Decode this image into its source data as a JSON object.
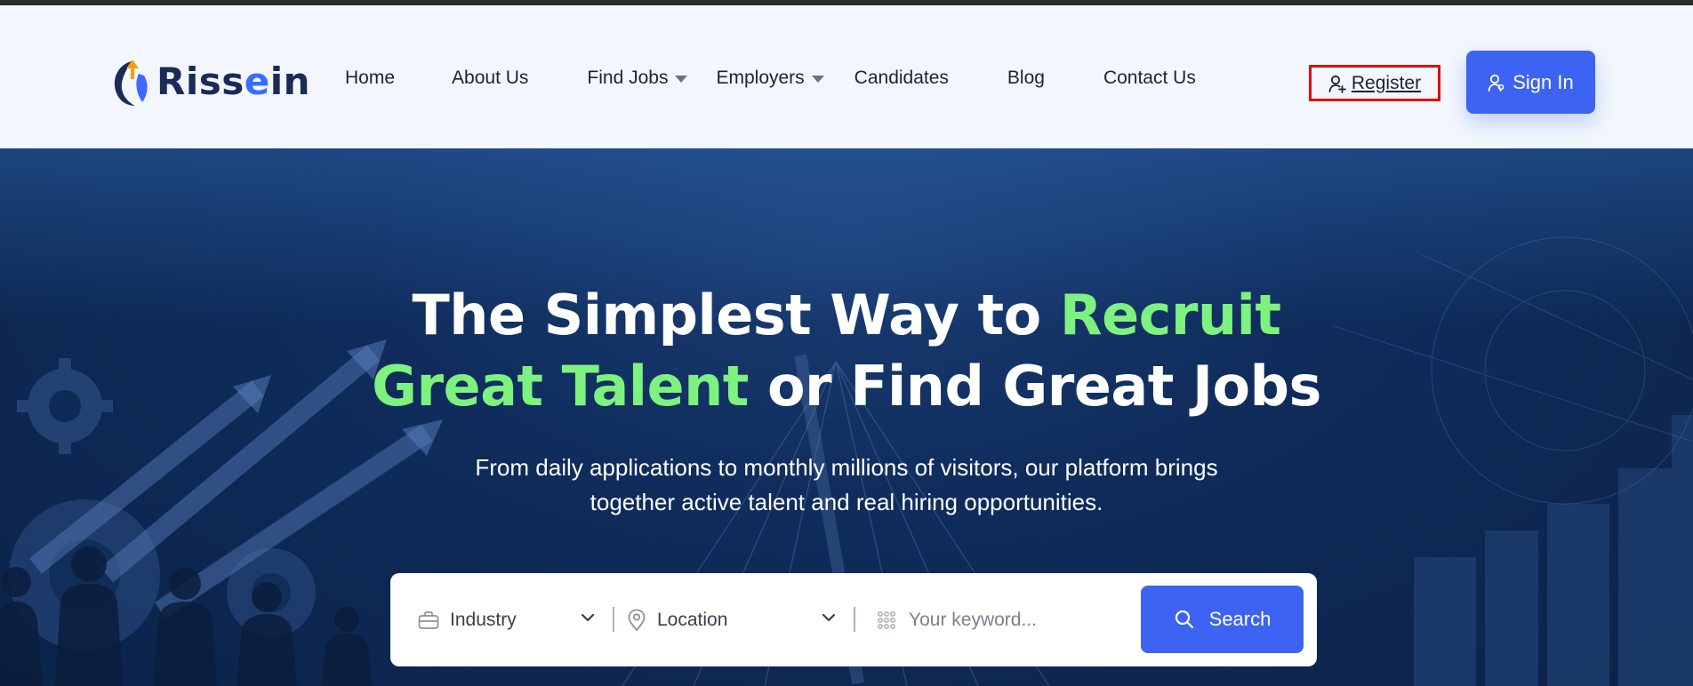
{
  "brand": {
    "name_prefix": "R",
    "name_mid": "iss",
    "name_accent": "e",
    "name_suffix": "in",
    "primary_color": "#3d63f2",
    "highlight_color": "#7ef27f"
  },
  "nav": {
    "items": [
      {
        "label": "Home",
        "has_dropdown": false
      },
      {
        "label": "About Us",
        "has_dropdown": false
      },
      {
        "label": "Find Jobs",
        "has_dropdown": true
      },
      {
        "label": "Employers",
        "has_dropdown": true
      },
      {
        "label": "Candidates",
        "has_dropdown": false
      },
      {
        "label": "Blog",
        "has_dropdown": false
      },
      {
        "label": "Contact Us",
        "has_dropdown": false
      }
    ],
    "register_label": "Register",
    "register_icon": "user-plus-icon",
    "signin_label": "Sign In",
    "signin_icon": "user-icon"
  },
  "hero": {
    "headline_part1": "The Simplest Way to ",
    "headline_highlight1": "Recruit",
    "headline_highlight2": "Great Talent",
    "headline_part2": " or Find Great Jobs",
    "subtext_line1": "From daily applications to monthly millions of visitors, our platform brings",
    "subtext_line2": "together active talent and real hiring opportunities."
  },
  "search": {
    "industry_label": "Industry",
    "industry_icon": "briefcase-icon",
    "location_label": "Location",
    "location_icon": "map-pin-icon",
    "keyword_placeholder": "Your keyword...",
    "keyword_icon": "grid-dots-icon",
    "button_label": "Search",
    "button_icon": "search-icon"
  }
}
